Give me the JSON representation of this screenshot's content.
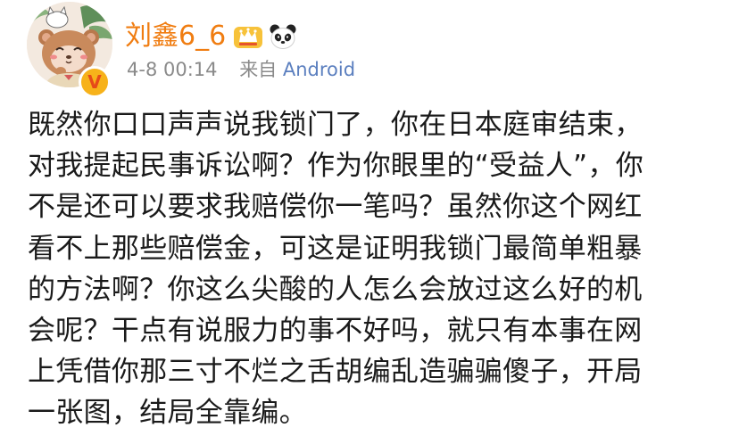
{
  "post": {
    "author": {
      "name": "刘鑫6_6",
      "verified_badge": "V",
      "icons": [
        "crown-vip-icon",
        "panda-icon"
      ]
    },
    "meta": {
      "time": "4-8 00:14",
      "source_label": "来自",
      "source": "Android"
    },
    "lines": [
      "既然你口口声声说我锁门了，你在日本庭审结束，",
      "对我提起民事诉讼啊？作为你眼里的“受益人”，你",
      "不是还可以要求我赔偿你一笔吗？虽然你这个网红",
      "看不上那些赔偿金，可这是证明我锁门最简单粗暴",
      "的方法啊？你这么尖酸的人怎么会放过这么好的机",
      "会呢？干点有说服力的事不好吗，就只有本事在网",
      "上凭借你那三寸不烂之舌胡编乱造骗骗傻子，开局",
      "一张图，结局全靠编。"
    ]
  },
  "colors": {
    "username": "#f07d11",
    "meta": "#8a8a8a",
    "source_link": "#5b7fbf",
    "body_text": "#1a1a1a",
    "verified_badge": "#f7b21a"
  }
}
